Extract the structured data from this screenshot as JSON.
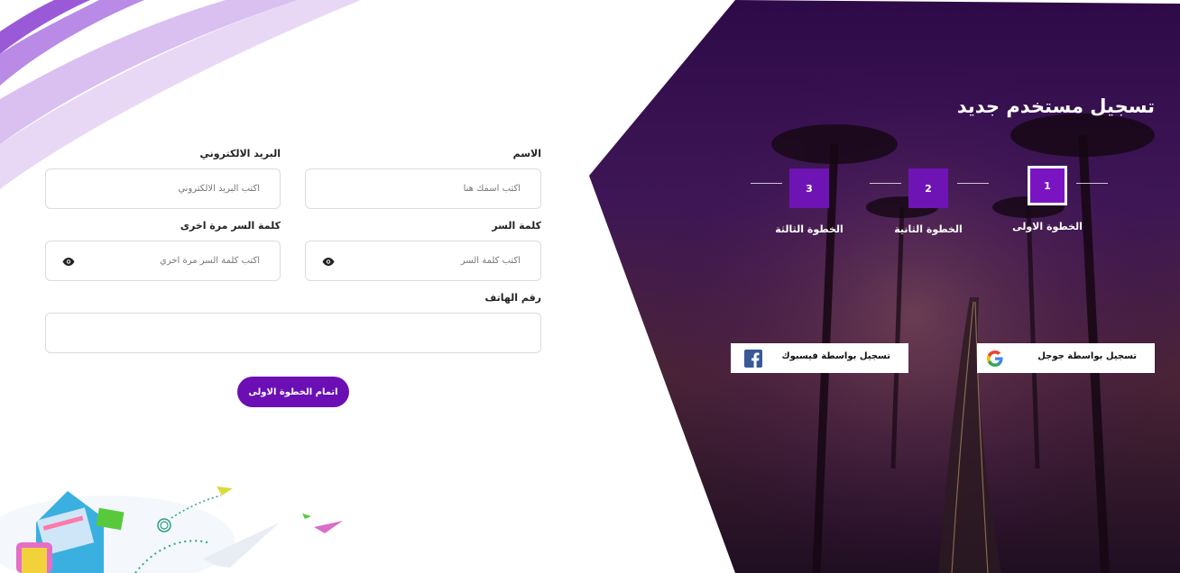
{
  "hero": {
    "title": "تسجيل مستخدم جديد",
    "steps": [
      {
        "number": "1",
        "label": "الخطوة الاولى",
        "active": true
      },
      {
        "number": "2",
        "label": "الخطوة الثانية",
        "active": false
      },
      {
        "number": "3",
        "label": "الخطوة الثالثة",
        "active": false
      }
    ],
    "google_label": "تسجيل بواسطة جوجل",
    "facebook_label": "تسجيل بواسطة فيسبوك"
  },
  "form": {
    "name": {
      "label": "الاسم",
      "placeholder": "اكتب اسمك هنا",
      "value": ""
    },
    "email": {
      "label": "البريد الالكتروني",
      "placeholder": "اكتب البريد الالكتروني",
      "value": ""
    },
    "password": {
      "label": "كلمة السر",
      "placeholder": "اكتب كلمة السر",
      "value": ""
    },
    "password_confirm": {
      "label": "كلمة السر مرة اخرى",
      "placeholder": "اكتب كلمة السر مرة اخري",
      "value": ""
    },
    "phone": {
      "label": "رقم الهاتف",
      "placeholder": "",
      "value": ""
    },
    "submit_label": "اتمام الخطوة الاولى"
  },
  "colors": {
    "accent": "#6b0fb5",
    "hero_overlay": "#3a0d55",
    "swoosh": "#b68ae0"
  },
  "icons": {
    "eye": "eye-icon",
    "google": "google-icon",
    "facebook": "facebook-icon"
  }
}
